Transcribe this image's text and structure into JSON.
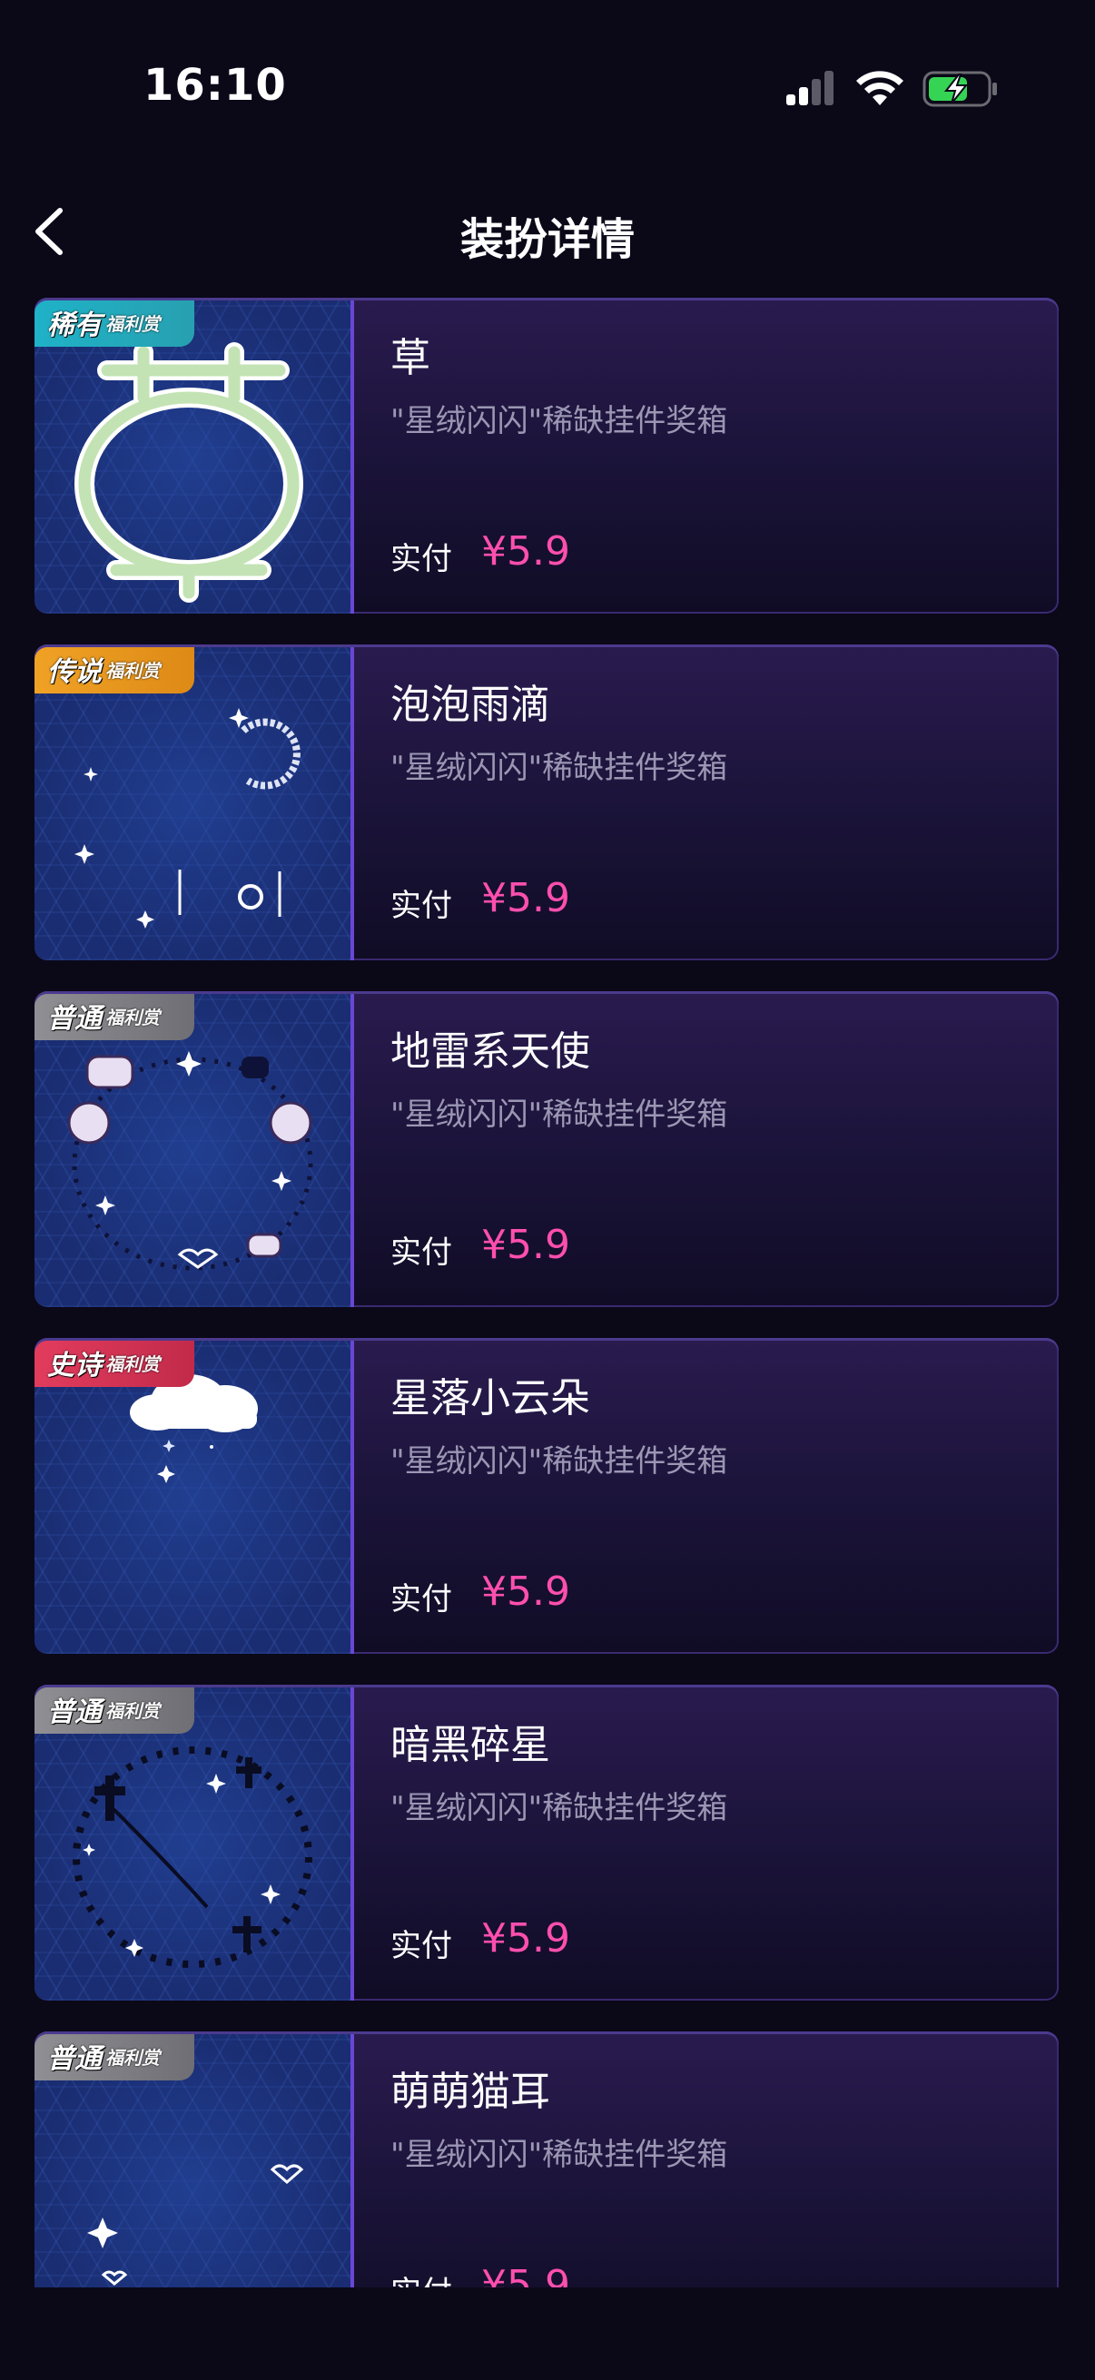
{
  "status": {
    "time": "16:10"
  },
  "nav": {
    "title": "装扮详情"
  },
  "items": [
    {
      "name": "草",
      "source": "\"星绒闪闪\"稀缺挂件奖箱",
      "price_label": "实付",
      "price": "¥5.9",
      "badge_tier": "稀有",
      "badge_perk": "福利赏",
      "badge_color": "#1fb2c8"
    },
    {
      "name": "泡泡雨滴",
      "source": "\"星绒闪闪\"稀缺挂件奖箱",
      "price_label": "实付",
      "price": "¥5.9",
      "badge_tier": "传说",
      "badge_perk": "福利赏",
      "badge_color": "#f0a225"
    },
    {
      "name": "地雷系天使",
      "source": "\"星绒闪闪\"稀缺挂件奖箱",
      "price_label": "实付",
      "price": "¥5.9",
      "badge_tier": "普通",
      "badge_perk": "福利赏",
      "badge_color": "#8f8f94"
    },
    {
      "name": "星落小云朵",
      "source": "\"星绒闪闪\"稀缺挂件奖箱",
      "price_label": "实付",
      "price": "¥5.9",
      "badge_tier": "史诗",
      "badge_perk": "福利赏",
      "badge_color": "#e23c5d"
    },
    {
      "name": "暗黑碎星",
      "source": "\"星绒闪闪\"稀缺挂件奖箱",
      "price_label": "实付",
      "price": "¥5.9",
      "badge_tier": "普通",
      "badge_perk": "福利赏",
      "badge_color": "#8f8f94"
    },
    {
      "name": "萌萌猫耳",
      "source": "\"星绒闪闪\"稀缺挂件奖箱",
      "price_label": "实付",
      "price": "¥5.9",
      "badge_tier": "普通",
      "badge_perk": "福利赏",
      "badge_color": "#8f8f94"
    }
  ],
  "colors": {
    "background": "#0b0818",
    "price": "#ff4fae",
    "secondary_text": "#9b97b3"
  },
  "icons": [
    "back-arrow-icon",
    "cellular-signal-icon",
    "wifi-icon",
    "battery-charging-icon"
  ]
}
